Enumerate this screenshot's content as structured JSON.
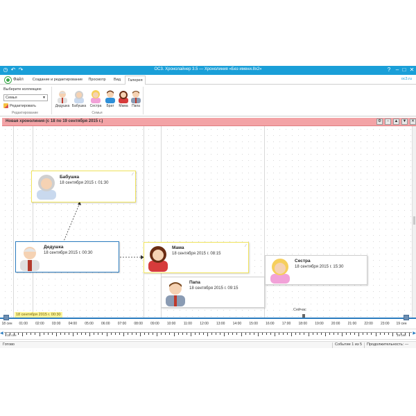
{
  "window": {
    "title": "OC3. Хронолайнер 3.5 — Хронолиния «Без имени.8x2»"
  },
  "ribbon": {
    "file_label": "Файл",
    "tabs": [
      {
        "label": "Создание и редактирование"
      },
      {
        "label": "Просмотр"
      },
      {
        "label": "Вид"
      },
      {
        "label": "Галерея"
      }
    ],
    "active_tab": "Галерея",
    "site_link": "oc3.ru",
    "collection_label": "Выберите коллекцию",
    "collection_value": "Семья",
    "edit_label": "Редактировать",
    "group_edit_label": "Редактирование",
    "group_family_label": "Семья",
    "gallery": [
      {
        "label": "Дедушка",
        "icon": "grandpa-icon"
      },
      {
        "label": "Бабушка",
        "icon": "grandma-icon"
      },
      {
        "label": "Сестра",
        "icon": "sister-icon"
      },
      {
        "label": "Брат",
        "icon": "brother-icon"
      },
      {
        "label": "Мама",
        "icon": "mom-icon"
      },
      {
        "label": "Папа",
        "icon": "dad-icon"
      }
    ]
  },
  "timeline": {
    "title": "Новая хронолиния (с 18 по 19 сентября 2015 г.)",
    "events": [
      {
        "name": "Бабушка",
        "date": "18 сентября 2015 г. 01:30"
      },
      {
        "name": "Дедушка",
        "date": "18 сентября 2015 г. 00:30"
      },
      {
        "name": "Мама",
        "date": "18 сентября 2015 г. 08:15"
      },
      {
        "name": "Папа",
        "date": "18 сентября 2015 г. 09:15"
      },
      {
        "name": "Сестра",
        "date": "18 сентября 2015 г. 15:30"
      }
    ],
    "now_label": "Сейчас",
    "selected_date_label": "18 сентября 2015 г. 00:30",
    "axis_labels": [
      "18 сен",
      "01:00",
      "02:00",
      "03:00",
      "04:00",
      "05:00",
      "06:00",
      "07:00",
      "08:00",
      "09:00",
      "10:00",
      "11:00",
      "12:00",
      "13:00",
      "14:00",
      "15:00",
      "16:00",
      "17:00",
      "18:00",
      "19:00",
      "20:00",
      "21:00",
      "22:00",
      "23:00",
      "19 сен"
    ],
    "overview_left": "18 сен",
    "overview_right": "19 сен"
  },
  "status": {
    "left": "Готово",
    "event_counter": "Событие 1 из 5",
    "duration_label": "Продолжительность: ---"
  },
  "colors": {
    "titlebar": "#1a9fd8",
    "header": "#f3a3a6",
    "axis": "#2a7bbf",
    "highlight": "#f0e35a"
  }
}
